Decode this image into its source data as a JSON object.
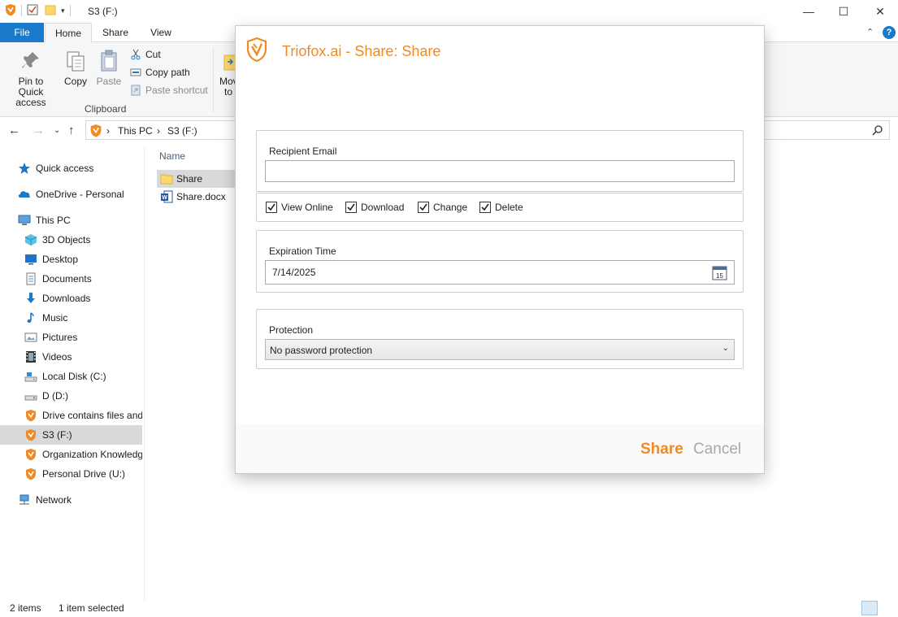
{
  "window": {
    "title": "S3 (F:)",
    "minimize": "—",
    "maximize": "☐",
    "close": "✕"
  },
  "ribbon_tabs": {
    "file": "File",
    "home": "Home",
    "share": "Share",
    "view": "View"
  },
  "ribbon": {
    "pin_label": "Pin to Quick access",
    "pin_line1": "Pin to Quick",
    "pin_line2": "access",
    "copy_label": "Copy",
    "paste_label": "Paste",
    "cut_label": "Cut",
    "copy_path_label": "Copy path",
    "paste_shortcut_label": "Paste shortcut",
    "clipboard_group": "Clipboard",
    "move_to_line1": "Mov",
    "move_to_line2": "to"
  },
  "address": {
    "crumbs": [
      "This PC",
      "S3 (F:)"
    ],
    "separator": "›"
  },
  "left_nav": {
    "items": [
      {
        "label": "Quick access",
        "icon": "star-icon"
      },
      {
        "label": "OneDrive - Personal",
        "icon": "cloud-icon"
      },
      {
        "label": "This PC",
        "icon": "computer-icon"
      },
      {
        "label": "3D Objects",
        "icon": "cube-icon"
      },
      {
        "label": "Desktop",
        "icon": "desktop-icon"
      },
      {
        "label": "Documents",
        "icon": "documents-icon"
      },
      {
        "label": "Downloads",
        "icon": "download-icon"
      },
      {
        "label": "Music",
        "icon": "music-icon"
      },
      {
        "label": "Pictures",
        "icon": "pictures-icon"
      },
      {
        "label": "Videos",
        "icon": "videos-icon"
      },
      {
        "label": "Local Disk (C:)",
        "icon": "drive-icon"
      },
      {
        "label": "D (D:)",
        "icon": "drive-icon"
      },
      {
        "label": "Drive contains files and",
        "icon": "triofox-drive-icon"
      },
      {
        "label": "S3 (F:)",
        "icon": "triofox-drive-icon"
      },
      {
        "label": "Organization Knowledg",
        "icon": "triofox-drive-icon"
      },
      {
        "label": "Personal Drive (U:)",
        "icon": "triofox-drive-icon"
      },
      {
        "label": "Network",
        "icon": "network-icon"
      }
    ]
  },
  "file_list": {
    "column_name": "Name",
    "rows": [
      {
        "name": "Share",
        "icon": "folder-icon"
      },
      {
        "name": "Share.docx",
        "icon": "word-doc-icon"
      }
    ]
  },
  "status_bar": {
    "items_count": "2 items",
    "selection": "1 item selected"
  },
  "dialog": {
    "title": "Triofox.ai - Share: Share",
    "recipient_label": "Recipient Email",
    "recipient_value": "",
    "permissions": [
      {
        "label": "View Online",
        "checked": true
      },
      {
        "label": "Download",
        "checked": true
      },
      {
        "label": "Change",
        "checked": true
      },
      {
        "label": "Delete",
        "checked": true
      }
    ],
    "expiration_label": "Expiration Time",
    "expiration_value": "7/14/2025",
    "calendar_day": "15",
    "protection_label": "Protection",
    "protection_value": "No password protection",
    "share_button": "Share",
    "cancel_button": "Cancel"
  },
  "colors": {
    "accent": "#f08a24",
    "file_tab": "#1979ca",
    "selection": "#d9d9d9"
  }
}
